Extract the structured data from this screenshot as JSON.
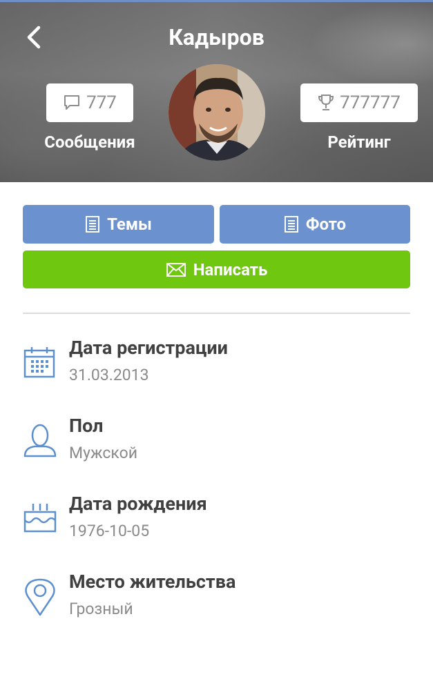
{
  "header": {
    "title": "Кадыров",
    "messages": {
      "count": "777",
      "label": "Сообщения"
    },
    "rating": {
      "count": "777777",
      "label": "Рейтинг"
    }
  },
  "actions": {
    "topics_label": "Темы",
    "photo_label": "Фото",
    "write_label": "Написать"
  },
  "info": [
    {
      "icon": "calendar-icon",
      "label": "Дата регистрации",
      "value": "31.03.2013"
    },
    {
      "icon": "user-icon",
      "label": "Пол",
      "value": "Мужской"
    },
    {
      "icon": "birthday-cake-icon",
      "label": "Дата рождения",
      "value": "1976-10-05"
    },
    {
      "icon": "location-pin-icon",
      "label": "Место жительства",
      "value": "Грозный"
    }
  ],
  "colors": {
    "accent_blue": "#6b92cf",
    "accent_green": "#6fc70f",
    "icon_blue": "#5b8fd0"
  }
}
